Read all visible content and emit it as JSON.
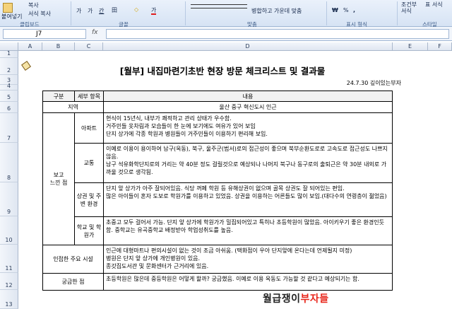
{
  "ribbon": {
    "paste_label": "붙여넣기",
    "copy_label": "복사",
    "format_painter_label": "서식 복사",
    "font_grow_icon": "가",
    "font_shrink_icon": "가",
    "bold_label": "가",
    "underline_label": "간",
    "border_label": "田",
    "fill_label": "◇",
    "fontcolor_label": "가",
    "merge_center_label": "병합하고 가운데 맞춤",
    "currency_label": "₩",
    "percent_label": "%",
    "comma_label": ",",
    "conditional_label": "조건부 서식",
    "table_label": "표 서식",
    "groups": {
      "clipboard": "클립보드",
      "font": "글꼴",
      "alignment": "맞춤",
      "number": "표시 형식",
      "styles": "스타일"
    }
  },
  "formula_bar": {
    "name_box": "J7",
    "fx": "fx",
    "value": ""
  },
  "columns": [
    "A",
    "B",
    "C",
    "D",
    "E",
    "F"
  ],
  "rows": [
    "1",
    "2",
    "3",
    "4",
    "5",
    "6",
    "7",
    "8",
    "9",
    "10",
    "11",
    "12",
    "13"
  ],
  "sheet": {
    "title": "[월부] 내집마련기초반 현장 방문 체크리스트 및 결과물",
    "date": "24.7.30 깊이있는부자",
    "header_gubun": "구분",
    "header_item": "세부 항목",
    "header_content": "내용",
    "region_label": "지역",
    "region_value": "울산 중구 혁신도시 인근",
    "group_label": "보고\n느낀 점",
    "apt_label": "아파트",
    "apt_text": "현식이 15년식, 내부가 쾌적하고 관리 상태가 우수함.\n거주민들 옷차림과 모습들이 한 눈에 보기에도 여유가 있어 보임\n단지 상가에 각종 학원과 병원들이 거주민들이 이용하기 편리해 보임.",
    "traffic_label": "교통",
    "traffic_text": "이예로 이용이 용이하여 남구(옥동), 북구, 울주군(범서)로의 접근성이 좋으며 북부순환도로로 고속도로 접근성도 나쁘지 않음.\n남구 석유화학단지로의 거리는 약 40분 정도 걸릴것으로 예상되나 나머지 북구나 동구로의 출퇴근은 약 30분 내외로 가까울 것으로 생각됨.",
    "commerce_label": "상권 및 주변 환경",
    "commerce_text": "단지 앞 상가가 아주 잘되어있음. 식당 꺼페 학원 등 유해상권이 없으며 골목 상권도 잘 되어있는 편임.\n많은 아이들이 혼자 도보로 학원가를 이용하고 있었음. 상권을 이용하는 어른들도 많이 보임.(대다수의 연령층이 젊었음)",
    "school_label": "학교 및 학원가",
    "school_text": "초중고 모두 걸어서 가능. 단지 앞 상가에 학원가가 밀집되어있고 특히나 초등학원이 많았음. 아이키우기 좋은 환경인듯함. 중학교는 유곡중학교 배정받아 학업성취도를 높음.",
    "infra_label": "인접한 주요 시설",
    "infra_text": "인근에 대형마트나 편의시설이 없는 것이 조금 아쉬움. (택화점이 우아 단지앞에 온다는데 언제될지 미정)\n병원은 단지 앞 상가에 개인병원이 있음.\n종갓집도서관 및 문화센터가 근거리에 있음.",
    "question_label": "궁금한 점",
    "question_text": "초등학원은 많은데 중등학원은 어떻게 할까? 궁금했음. 이예로 이용 옥동도 가능할 것 같다고 예상되기는 함."
  },
  "watermark": {
    "part1": "월급쟁이",
    "part2": "부자들"
  }
}
